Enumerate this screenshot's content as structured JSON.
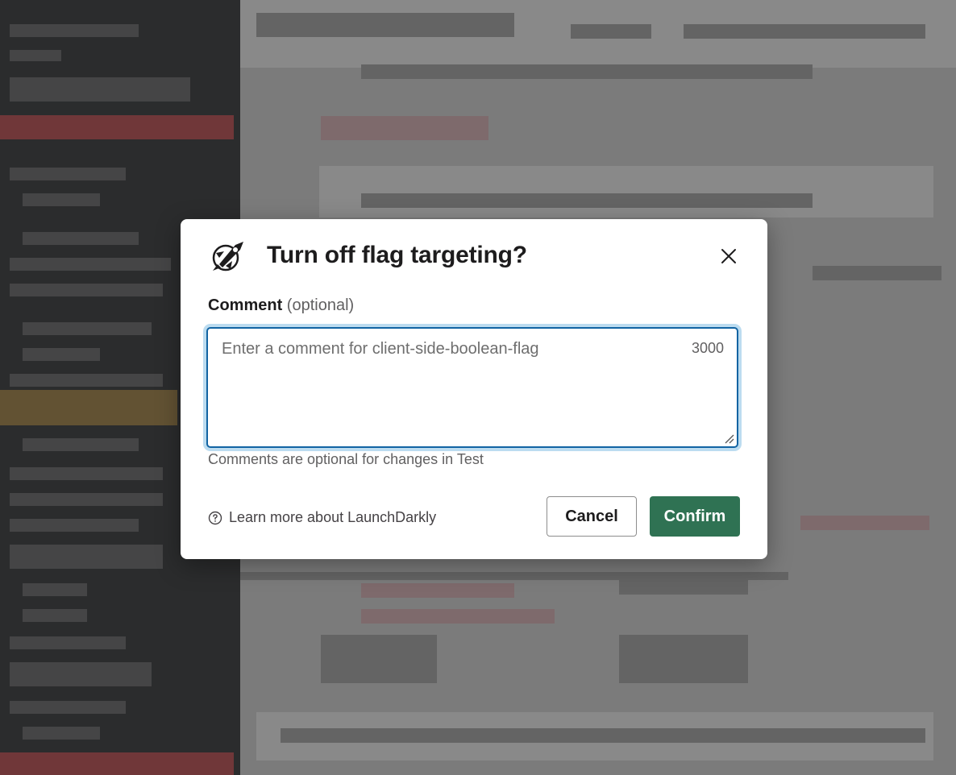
{
  "dialog": {
    "title": "Turn off flag targeting?",
    "comment_label": "Comment",
    "comment_optional": "(optional)",
    "comment_placeholder": "Enter a comment for client-side-boolean-flag",
    "comment_value": "",
    "char_counter": "3000",
    "hint": "Comments are optional for changes in Test",
    "learn_more": "Learn more about LaunchDarkly",
    "cancel_label": "Cancel",
    "confirm_label": "Confirm",
    "icons": {
      "logo": "launchdarkly-rocket-logo",
      "close": "close-icon",
      "help": "question-circle-icon"
    }
  },
  "colors": {
    "confirm_bg": "#2f7253",
    "focus_border": "#1264a3",
    "focus_ring": "#bcdcf0"
  }
}
